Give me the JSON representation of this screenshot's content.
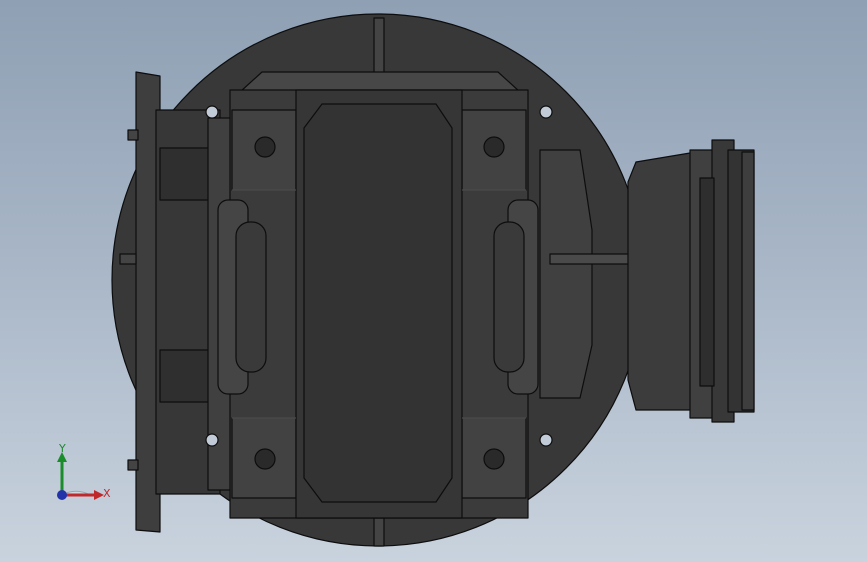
{
  "view": {
    "background_top": "#8fa0b4",
    "background_bottom": "#c9d3de",
    "model_fill": "#3a3a3a",
    "model_edge": "#0d0d0d",
    "model_highlight": "#4a4a4a"
  },
  "triad": {
    "y_label": "Y",
    "x_label": "X",
    "y_color": "#1a8c2a",
    "x_color": "#c0282a",
    "z_color": "#2233aa"
  }
}
